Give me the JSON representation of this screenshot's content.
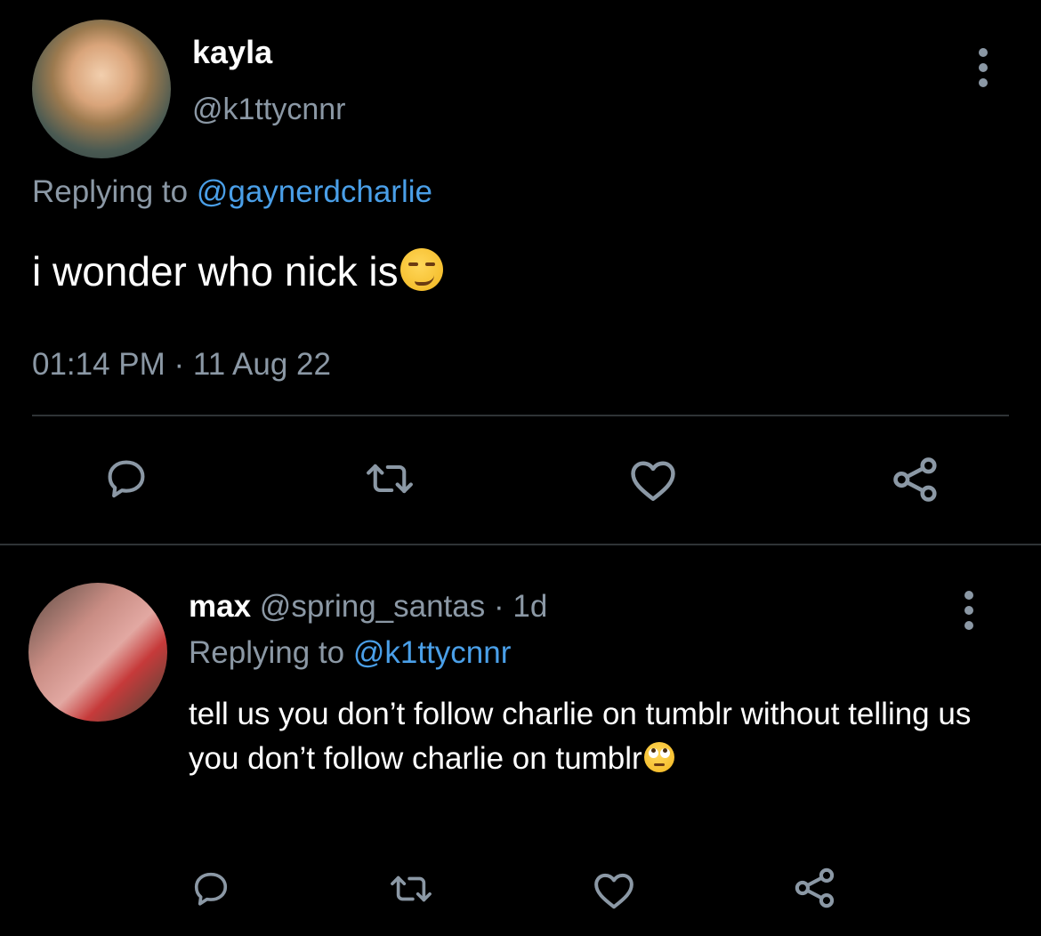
{
  "main_tweet": {
    "display_name": "kayla",
    "handle": "@k1ttycnnr",
    "replying_prefix": "Replying to",
    "replying_to": "@gaynerdcharlie",
    "text": "i wonder who nick is",
    "emoji": "smirking-face",
    "timestamp": "01:14 PM · 11 Aug 22"
  },
  "reply_tweet": {
    "display_name": "max",
    "handle": "@spring_santas",
    "separator": "·",
    "age": "1d",
    "replying_prefix": "Replying to",
    "replying_to": "@k1ttycnnr",
    "text": "tell us you don’t follow charlie on tumblr without telling us you don’t follow charlie on tumblr",
    "emoji": "face-with-rolling-eyes"
  },
  "actions": [
    "reply-icon",
    "retweet-icon",
    "like-icon",
    "share-icon"
  ],
  "colors": {
    "background": "#000000",
    "primary_text": "#ffffff",
    "secondary_text": "#8b98a5",
    "link": "#4a9fe8",
    "divider": "#2f3336"
  }
}
